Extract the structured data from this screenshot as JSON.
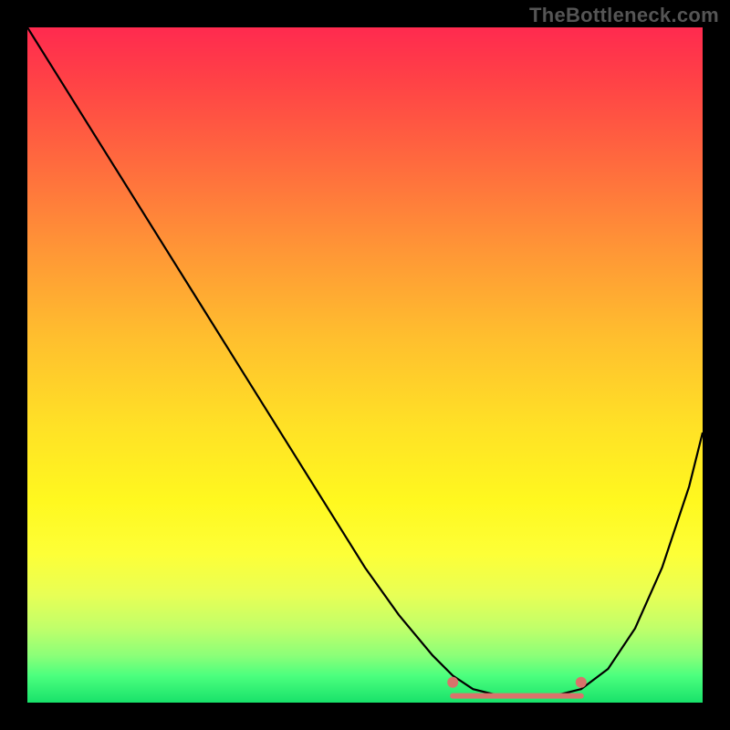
{
  "watermark": "TheBottleneck.com",
  "colors": {
    "frame": "#000000",
    "curve": "#000000",
    "marker": "#d9736b",
    "gradient_top": "#ff2a4f",
    "gradient_bottom": "#18e26a"
  },
  "chart_data": {
    "type": "line",
    "title": "",
    "xlabel": "",
    "ylabel": "",
    "xlim": [
      0,
      100
    ],
    "ylim": [
      0,
      100
    ],
    "grid": false,
    "legend": false,
    "series": [
      {
        "name": "bottleneck-curve",
        "x": [
          0,
          5,
          10,
          15,
          20,
          25,
          30,
          35,
          40,
          45,
          50,
          55,
          60,
          63,
          66,
          70,
          74,
          78,
          82,
          86,
          90,
          94,
          98,
          100
        ],
        "y": [
          100,
          92,
          84,
          76,
          68,
          60,
          52,
          44,
          36,
          28,
          20,
          13,
          7,
          4,
          2,
          1,
          1,
          1,
          2,
          5,
          11,
          20,
          32,
          40
        ]
      }
    ],
    "optimal_zone": {
      "x_start": 63,
      "x_end": 82,
      "y": 1
    },
    "optimal_markers": [
      {
        "x": 63,
        "y": 3
      },
      {
        "x": 82,
        "y": 3
      }
    ]
  }
}
